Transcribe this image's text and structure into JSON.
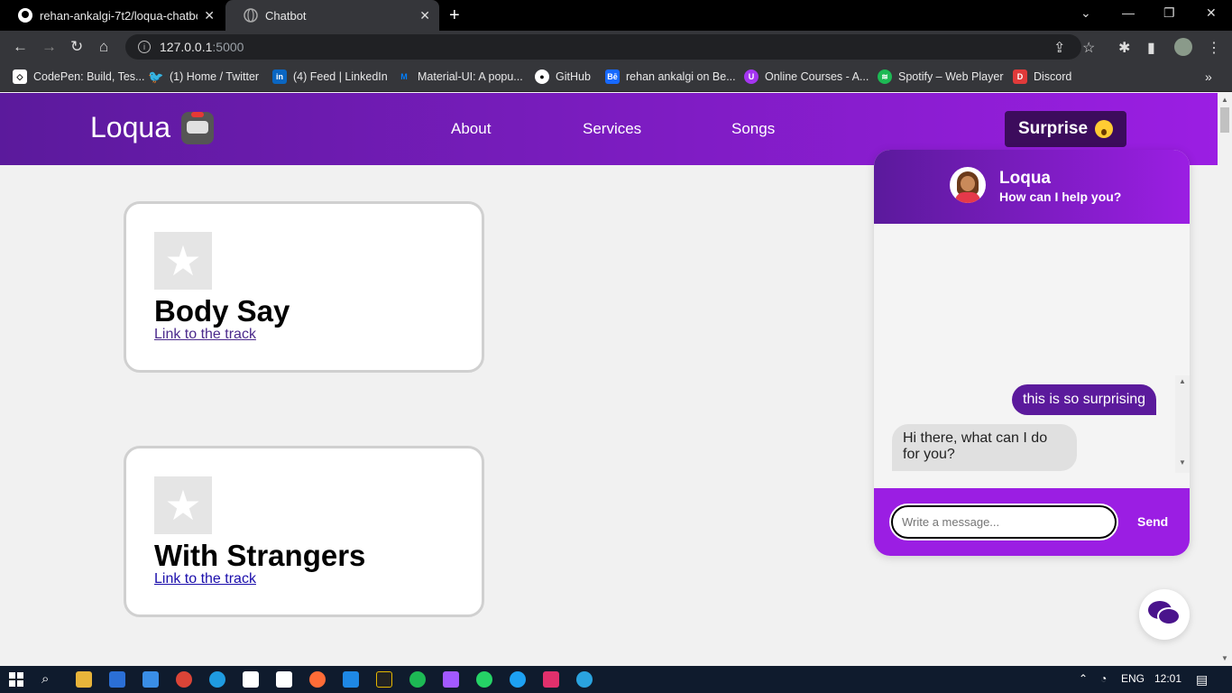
{
  "browser": {
    "tabs": [
      {
        "title": "rehan-ankalgi-7t2/loqua-chatbot",
        "icon": "github-icon",
        "active": false
      },
      {
        "title": "Chatbot",
        "icon": "globe-icon",
        "active": true
      }
    ],
    "url_host": "127.0.0.1",
    "url_port": ":5000",
    "bookmarks": [
      {
        "label": "CodePen: Build, Tes...",
        "icon": "codepen-icon",
        "color": "#000000"
      },
      {
        "label": "(1) Home / Twitter",
        "icon": "twitter-icon",
        "color": "#1da1f2"
      },
      {
        "label": "(4) Feed | LinkedIn",
        "icon": "linkedin-icon",
        "color": "#0a66c2"
      },
      {
        "label": "Material-UI: A popu...",
        "icon": "mui-icon",
        "color": "#007fff"
      },
      {
        "label": "GitHub",
        "icon": "github-icon",
        "color": "#000000"
      },
      {
        "label": "rehan ankalgi on Be...",
        "icon": "behance-icon",
        "color": "#1769ff"
      },
      {
        "label": "Online Courses - A...",
        "icon": "udemy-icon",
        "color": "#a435f0"
      },
      {
        "label": "Spotify – Web Player",
        "icon": "spotify-icon",
        "color": "#1db954"
      },
      {
        "label": "Discord",
        "icon": "discord-icon",
        "color": "#e03a3a"
      }
    ]
  },
  "site": {
    "brand": "Loqua",
    "nav": [
      "About",
      "Services",
      "Songs"
    ],
    "surprise_label": "Surprise"
  },
  "songs": [
    {
      "title": "Body Say",
      "link_label": "Link to the track"
    },
    {
      "title": "With Strangers",
      "link_label": "Link to the track"
    }
  ],
  "chat": {
    "name": "Loqua",
    "subtitle": "How can I help you?",
    "messages": [
      {
        "from": "user",
        "text": "this is so surprising"
      },
      {
        "from": "bot",
        "text": "Hi there, what can I do for you?"
      }
    ],
    "input_placeholder": "Write a message...",
    "send_label": "Send"
  },
  "taskbar": {
    "lang": "ENG",
    "time": "12:01"
  },
  "colors": {
    "brand_dark": "#5b1a9c",
    "brand_light": "#9b1ee3"
  }
}
